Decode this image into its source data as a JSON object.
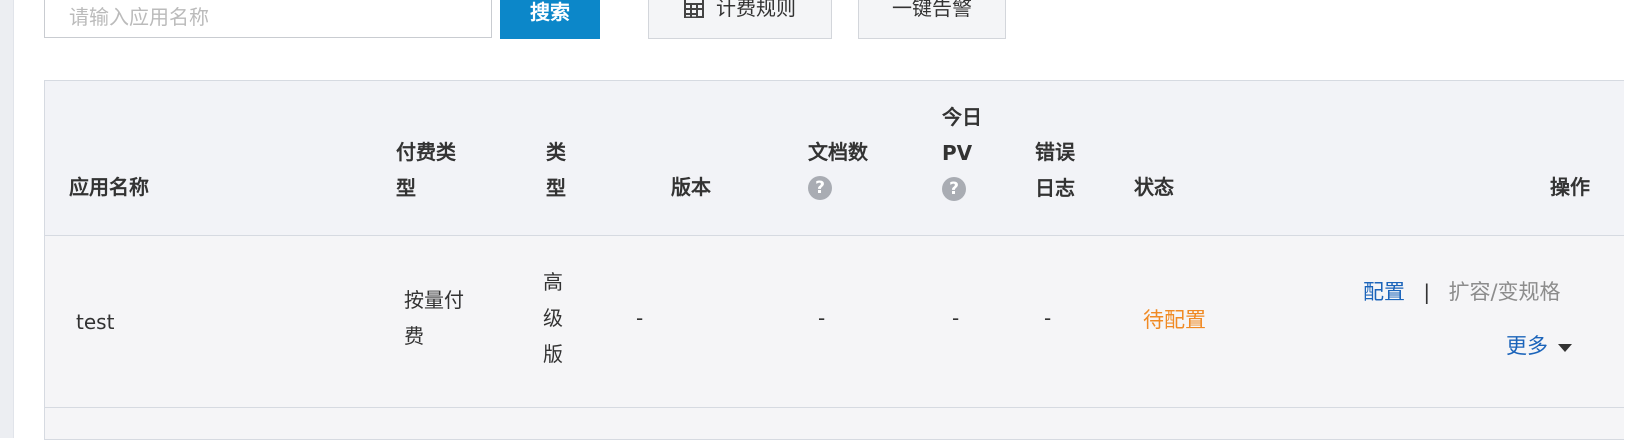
{
  "toolbar": {
    "search_placeholder": "请输入应用名称",
    "search_label": "搜索",
    "billing_label": "计费规则",
    "billing_icon": "calculator-icon",
    "alert_label": "一键告警"
  },
  "table": {
    "columns": {
      "app_name": "应用名称",
      "pay_type_1": "付费类",
      "pay_type_2": "型",
      "type_1": "类",
      "type_2": "型",
      "version": "版本",
      "doc_count": "文档数",
      "today_1": "今日",
      "today_2": "PV",
      "error_1": "错误",
      "error_2": "日志",
      "status": "状态",
      "actions": "操作",
      "help_icon_glyph": "?"
    },
    "rows": [
      {
        "name": "test",
        "pay_type_1": "按量付",
        "pay_type_2": "费",
        "type_1": "高",
        "type_2": "级",
        "type_3": "版",
        "version": "-",
        "doc_count": "-",
        "today_pv": "-",
        "error_log": "-",
        "status": "待配置",
        "action_config": "配置",
        "action_separator": "|",
        "action_scale": "扩容/变规格",
        "action_more": "更多"
      }
    ]
  },
  "colors": {
    "primary": "#0c87c9",
    "link": "#1b64ba",
    "pending": "#f08a24",
    "header_bg": "#f2f3f7"
  }
}
